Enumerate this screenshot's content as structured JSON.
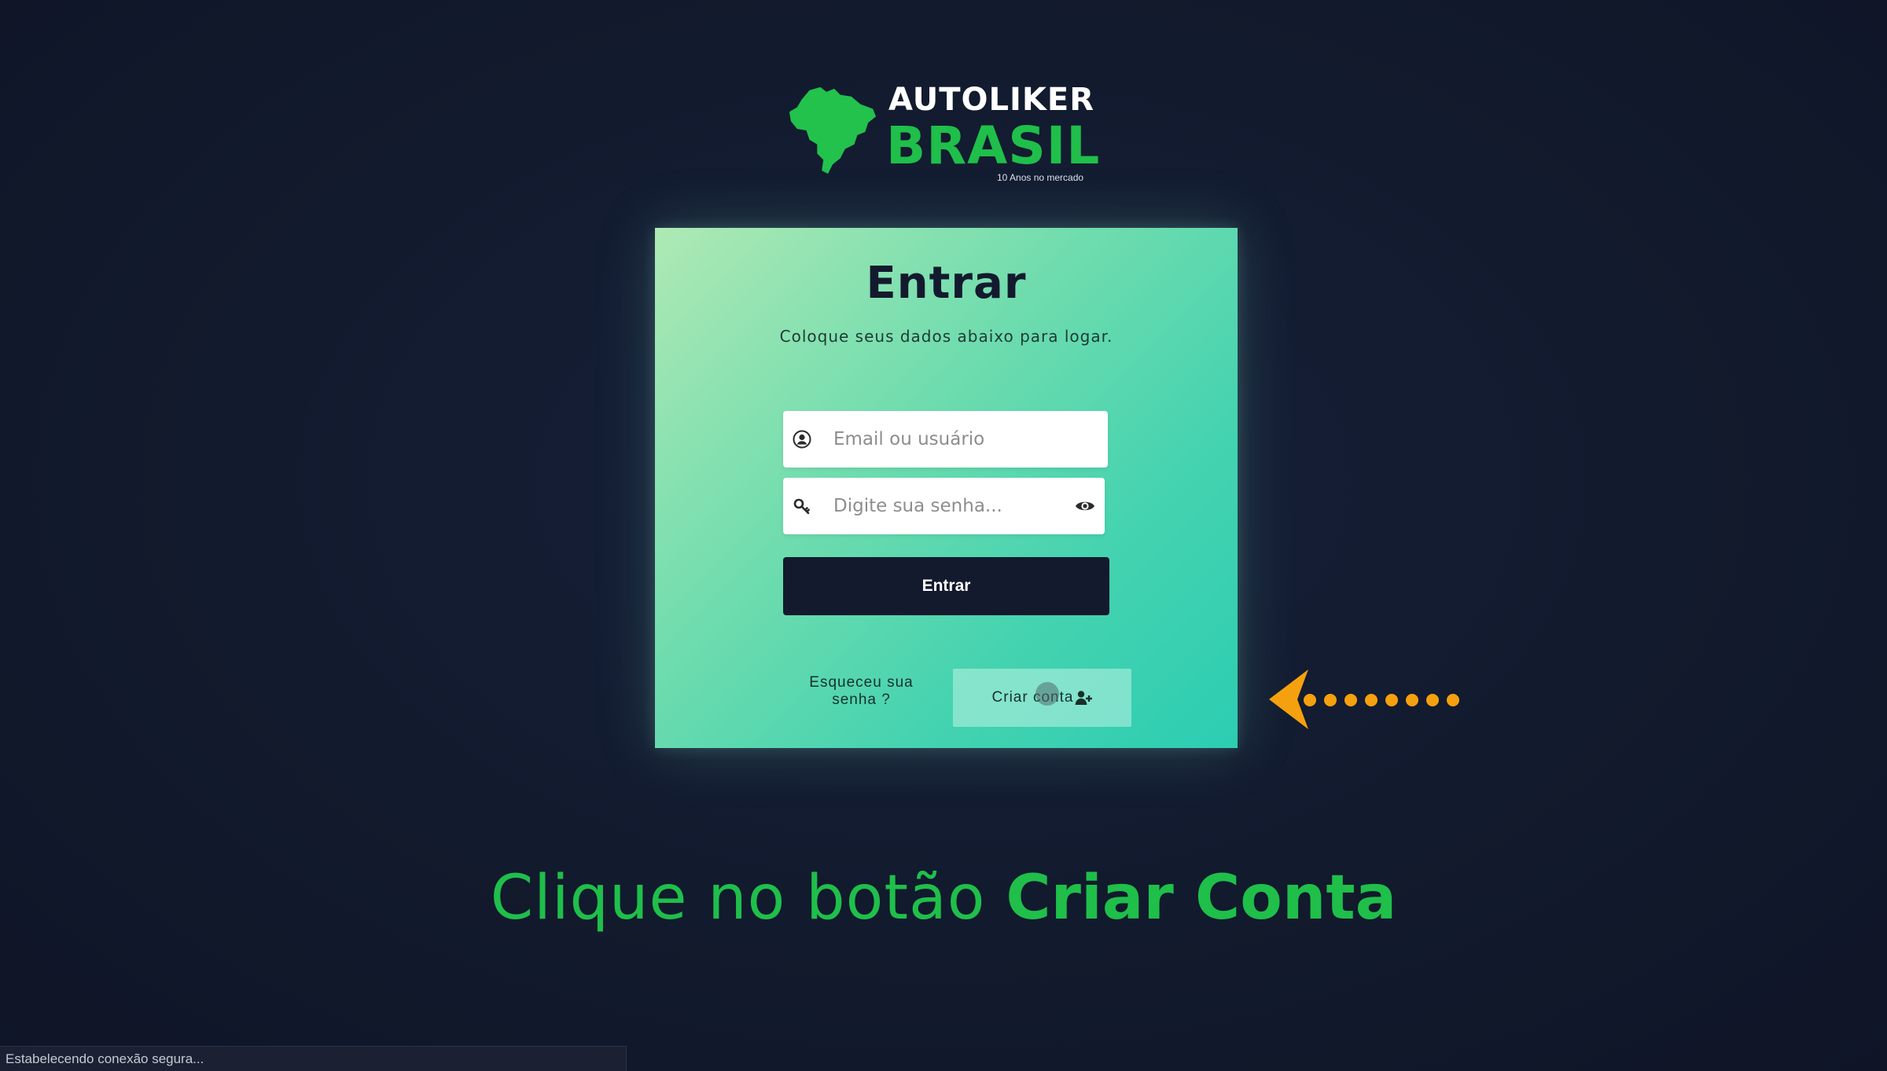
{
  "logo": {
    "line1": "AUTOLIKER",
    "line2": "BRASIL",
    "tagline": "10 Anos no mercado"
  },
  "login_card": {
    "title": "Entrar",
    "subtitle": "Coloque seus dados abaixo para logar.",
    "email_field": {
      "placeholder": "Email ou usuário",
      "value": ""
    },
    "password_field": {
      "placeholder": "Digite sua senha...",
      "value": ""
    },
    "submit_label": "Entrar",
    "forgot_label": "Esqueceu sua senha ?",
    "create_label": "Criar conta"
  },
  "instruction": {
    "prefix": "Clique no botão ",
    "highlight": "Criar Conta"
  },
  "status_bar": {
    "text": "Estabelecendo conexão segura..."
  },
  "colors": {
    "background": "#131a2e",
    "brand_green": "#1fbf4a",
    "arrow_orange": "#f5a10f",
    "button_dark": "#131a2e"
  },
  "icons": {
    "user": "user-circle-icon",
    "password": "key-icon",
    "show_password": "eye-icon",
    "create": "user-plus-icon",
    "map": "brazil-map-icon"
  }
}
